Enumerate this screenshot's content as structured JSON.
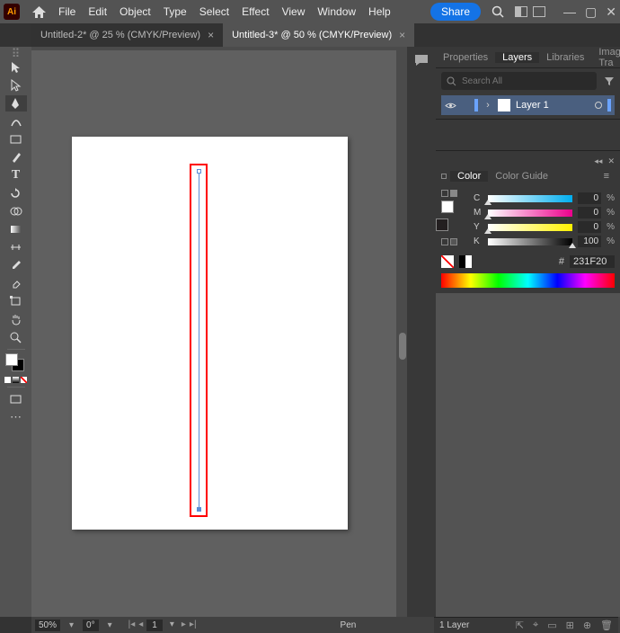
{
  "app": {
    "icon_label": "Ai"
  },
  "menu": [
    "File",
    "Edit",
    "Object",
    "Type",
    "Select",
    "Effect",
    "View",
    "Window",
    "Help"
  ],
  "share_label": "Share",
  "tabs": [
    {
      "label": "Untitled-2* @ 25 % (CMYK/Preview)",
      "active": false
    },
    {
      "label": "Untitled-3* @ 50 % (CMYK/Preview)",
      "active": true
    }
  ],
  "right_panel_tabs": [
    "Properties",
    "Layers",
    "Libraries",
    "Image Tra"
  ],
  "right_panel_active": "Layers",
  "layer_search_placeholder": "Search All",
  "layers": [
    {
      "name": "Layer 1"
    }
  ],
  "color_tabs": [
    "Color",
    "Color Guide"
  ],
  "color_active": "Color",
  "cmyk": {
    "C": "0",
    "M": "0",
    "Y": "0",
    "K": "100"
  },
  "hex_label": "#",
  "hex_value": "231F20",
  "status": {
    "zoom": "50%",
    "rotation": "0°",
    "page": "1",
    "tool": "Pen"
  },
  "right_status_label": "1 Layer"
}
